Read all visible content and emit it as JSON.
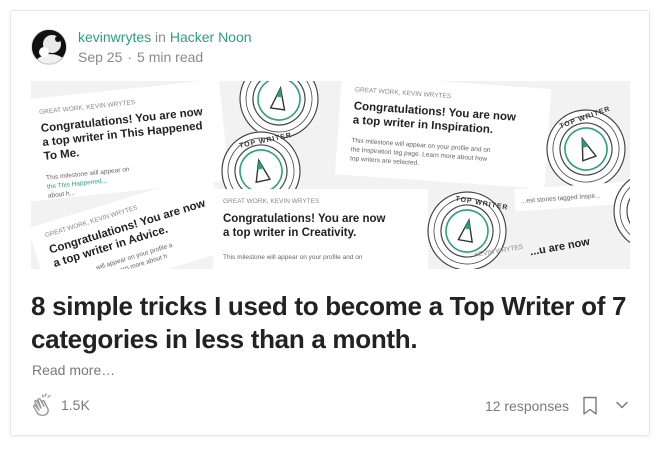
{
  "post": {
    "author": "kevinwrytes",
    "in_word": "in",
    "publication": "Hacker Noon",
    "date": "Sep 25",
    "separator": "·",
    "read_time": "5 min read",
    "title": "8 simple tricks I used to become a Top Writer of 7 categories in less than a month.",
    "read_more": "Read more…",
    "claps": "1.5K",
    "responses": "12 responses"
  },
  "hero": {
    "kicker": "GREAT WORK, KEVIN WRYTES",
    "cards": [
      {
        "headline_1": "Congratulations! You are now",
        "headline_2": "a top writer in This Happened",
        "headline_3": "To Me.",
        "body_1": "This milestone will appear on",
        "body_2": "the This Happened...",
        "body_3": "about h..."
      },
      {
        "headline_1": "Congratulations! You are now",
        "headline_2": "a top writer in Advice.",
        "body_1": "...will appear on your profile a",
        "body_2": "Learn more about h"
      },
      {
        "headline_1": "Congratulations! You are now",
        "headline_2": "a top writer in Inspiration.",
        "body_1": "This milestone will appear on your profile and on",
        "body_2": "the Inspiration tag page. Learn more about how",
        "body_3": "top writers are selected."
      },
      {
        "headline_1": "Congratulations! You are now",
        "headline_2": "a top writer in Creativity.",
        "body_1": "This milestone will appear on your profile and on"
      }
    ],
    "badge_text": "TOP WRITER",
    "misc_1": "...est stories tagged Inspir...",
    "misc_2": "KEVIN WRYTES",
    "misc_3": "...u are now"
  },
  "colors": {
    "accent": "#2a9f82",
    "muted": "#7a7a7a"
  },
  "icons": {
    "clap": "clap-icon",
    "bookmark": "bookmark-icon",
    "chevron": "chevron-down-icon"
  }
}
